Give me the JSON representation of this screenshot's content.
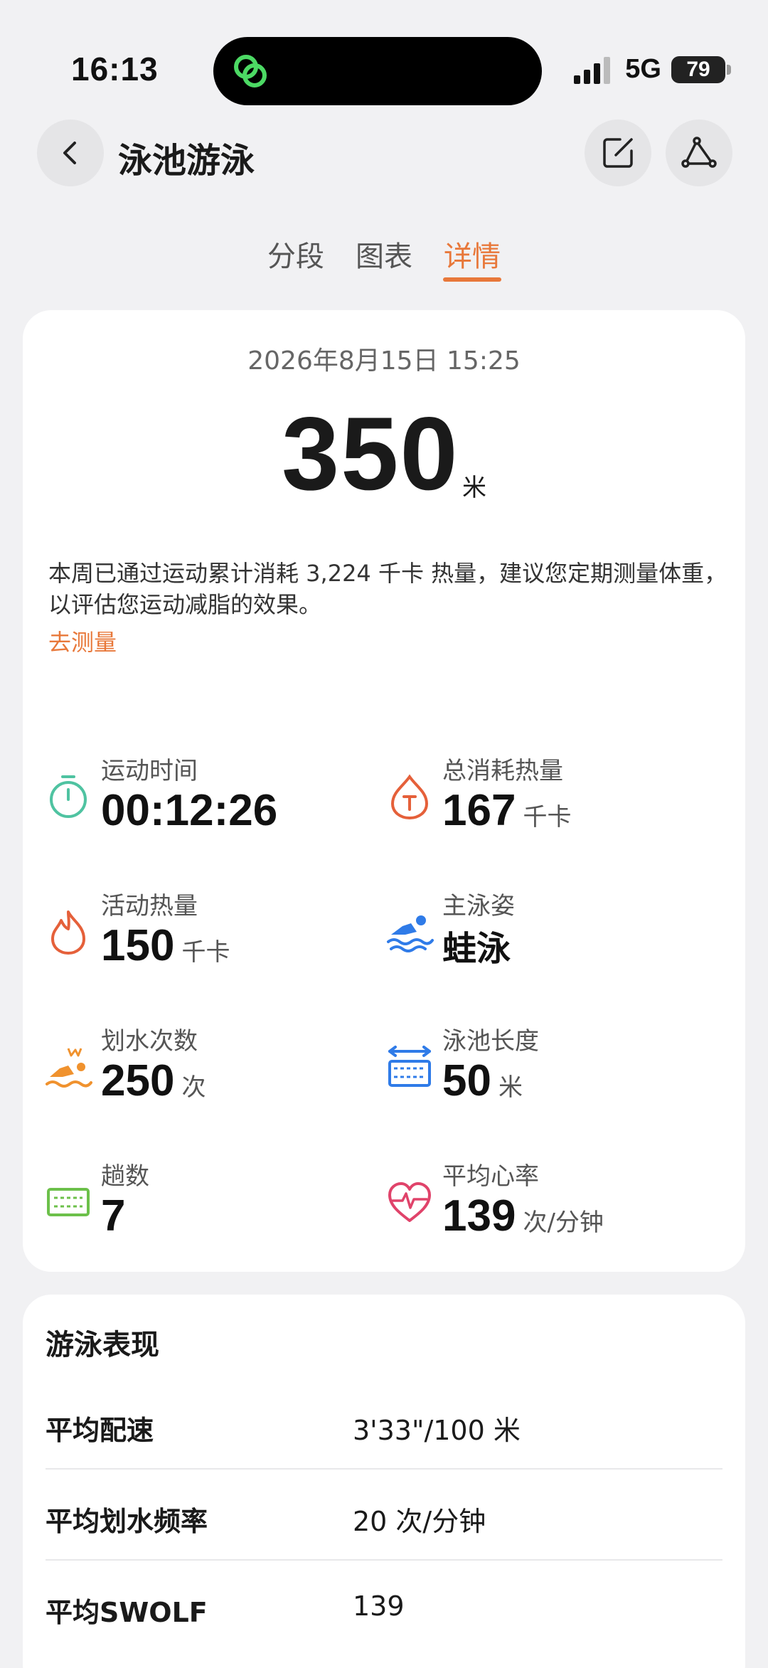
{
  "status_bar": {
    "time": "16:13",
    "network": "5G",
    "battery": "79",
    "icons": [
      "link-icon",
      "signal-icon",
      "battery-icon"
    ]
  },
  "header": {
    "title": "泳池游泳",
    "icons": [
      "back-icon",
      "edit-icon",
      "route-icon"
    ]
  },
  "tabs": [
    {
      "label": "分段",
      "active": false
    },
    {
      "label": "图表",
      "active": false
    },
    {
      "label": "详情",
      "active": true
    }
  ],
  "accent_color": "#e8783a",
  "summary": {
    "datetime": "2026年8月15日 15:25",
    "distance": "350",
    "distance_unit": "米",
    "tip": "本周已通过运动累计消耗 3,224 千卡 热量，建议您定期测量体重，以评估您运动减脂的效果。",
    "tip_link": "去测量"
  },
  "metrics": [
    {
      "label": "运动时间",
      "value": "00:12:26",
      "unit": "",
      "icon": "stopwatch-icon"
    },
    {
      "label": "总消耗热量",
      "value": "167",
      "unit": "千卡",
      "icon": "total-calorie-icon"
    },
    {
      "label": "活动热量",
      "value": "150",
      "unit": "千卡",
      "icon": "flame-icon"
    },
    {
      "label": "主泳姿",
      "value": "蛙泳",
      "unit": "",
      "icon": "swimmer-icon"
    },
    {
      "label": "划水次数",
      "value": "250",
      "unit": "次",
      "icon": "stroke-icon"
    },
    {
      "label": "泳池长度",
      "value": "50",
      "unit": "米",
      "icon": "pool-length-icon"
    },
    {
      "label": "趟数",
      "value": "7",
      "unit": "",
      "icon": "laps-icon"
    },
    {
      "label": "平均心率",
      "value": "139",
      "unit": "次/分钟",
      "icon": "heart-rate-icon"
    }
  ],
  "performance": {
    "title": "游泳表现",
    "rows": [
      {
        "label": "平均配速",
        "value": "3'33\"/100 米"
      },
      {
        "label": "平均划水频率",
        "value": "20 次/分钟"
      },
      {
        "label": "平均SWOLF",
        "value": "139"
      }
    ]
  }
}
